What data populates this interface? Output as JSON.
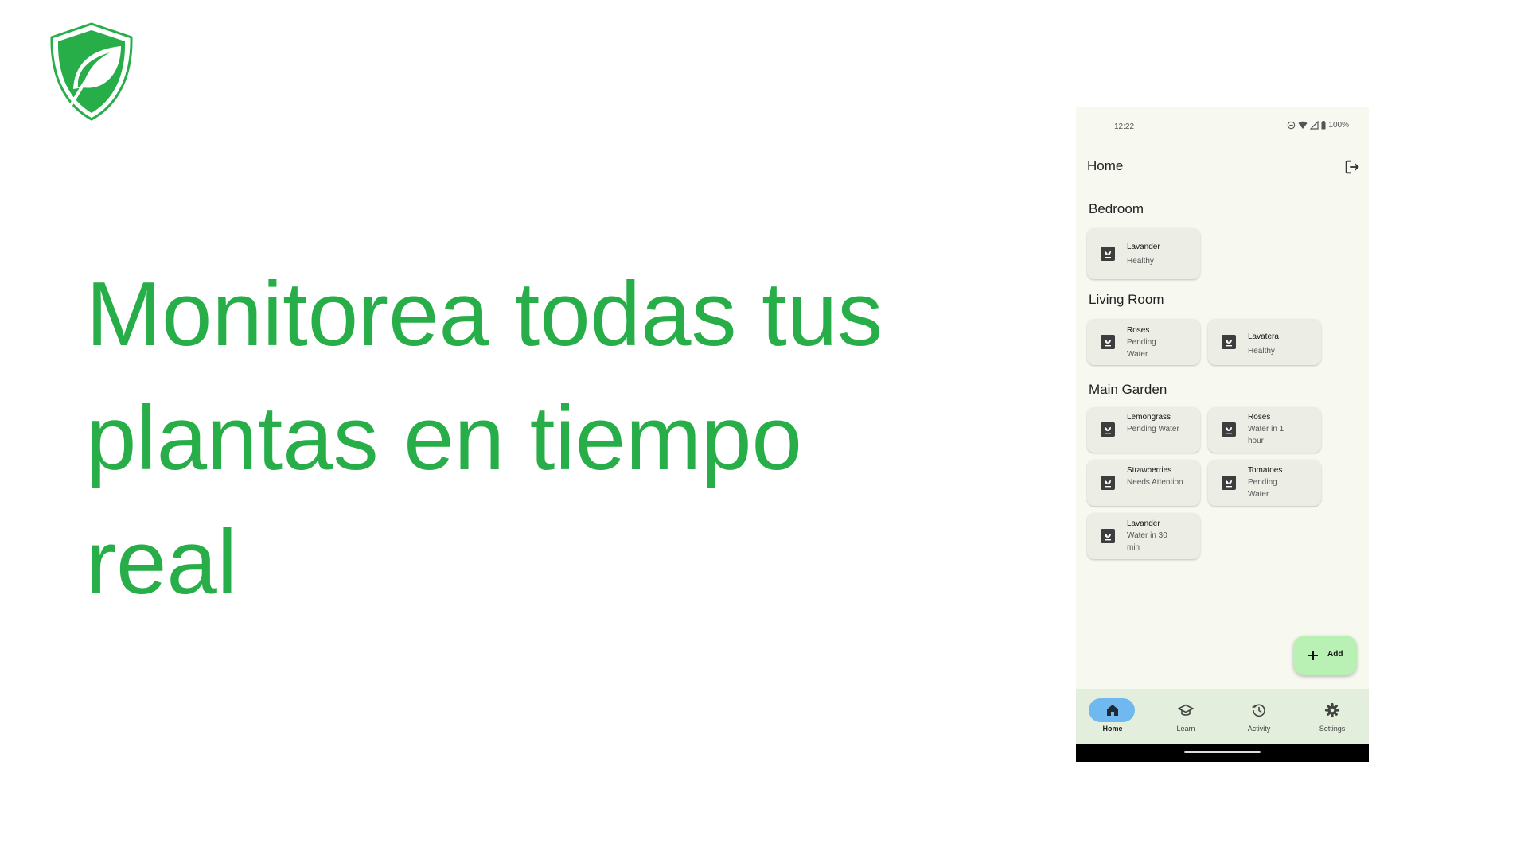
{
  "brand": {
    "logo_icon": "shield-leaf-icon",
    "accent_color": "#27ae48"
  },
  "headline": "Monitorea todas tus plantas en tiempo real",
  "phone": {
    "status_bar": {
      "time": "12:22",
      "battery": "100%",
      "icons": [
        "dnd-icon",
        "wifi-icon",
        "signal-icon",
        "battery-icon"
      ]
    },
    "app_bar": {
      "title": "Home",
      "logout_icon": "logout-icon"
    },
    "sections": [
      {
        "title": "Bedroom",
        "plants": [
          {
            "name": "Lavander",
            "status": "Healthy"
          }
        ]
      },
      {
        "title": "Living Room",
        "plants": [
          {
            "name": "Roses",
            "status": "Pending Water"
          },
          {
            "name": "Lavatera",
            "status": "Healthy"
          }
        ]
      },
      {
        "title": "Main Garden",
        "plants": [
          {
            "name": "Lemongrass",
            "status": "Pending Water"
          },
          {
            "name": "Roses",
            "status": "Water in 1 hour"
          },
          {
            "name": "Strawberries",
            "status": "Needs Attention"
          },
          {
            "name": "Tomatoes",
            "status": "Pending Water"
          },
          {
            "name": "Lavander",
            "status": "Water in 30 min"
          }
        ]
      }
    ],
    "fab": {
      "label": "Add",
      "icon": "plus-icon"
    },
    "nav": {
      "active": "Home",
      "items": [
        {
          "label": "Home",
          "icon": "home-icon"
        },
        {
          "label": "Learn",
          "icon": "graduation-cap-icon"
        },
        {
          "label": "Activity",
          "icon": "history-icon"
        },
        {
          "label": "Settings",
          "icon": "gear-icon"
        }
      ]
    },
    "colors": {
      "background": "#f7f9f1",
      "card": "#eceee6",
      "fab": "#b9f0b4",
      "nav_bar": "#e3eedc",
      "nav_active_pill": "#6fb9f0"
    }
  }
}
